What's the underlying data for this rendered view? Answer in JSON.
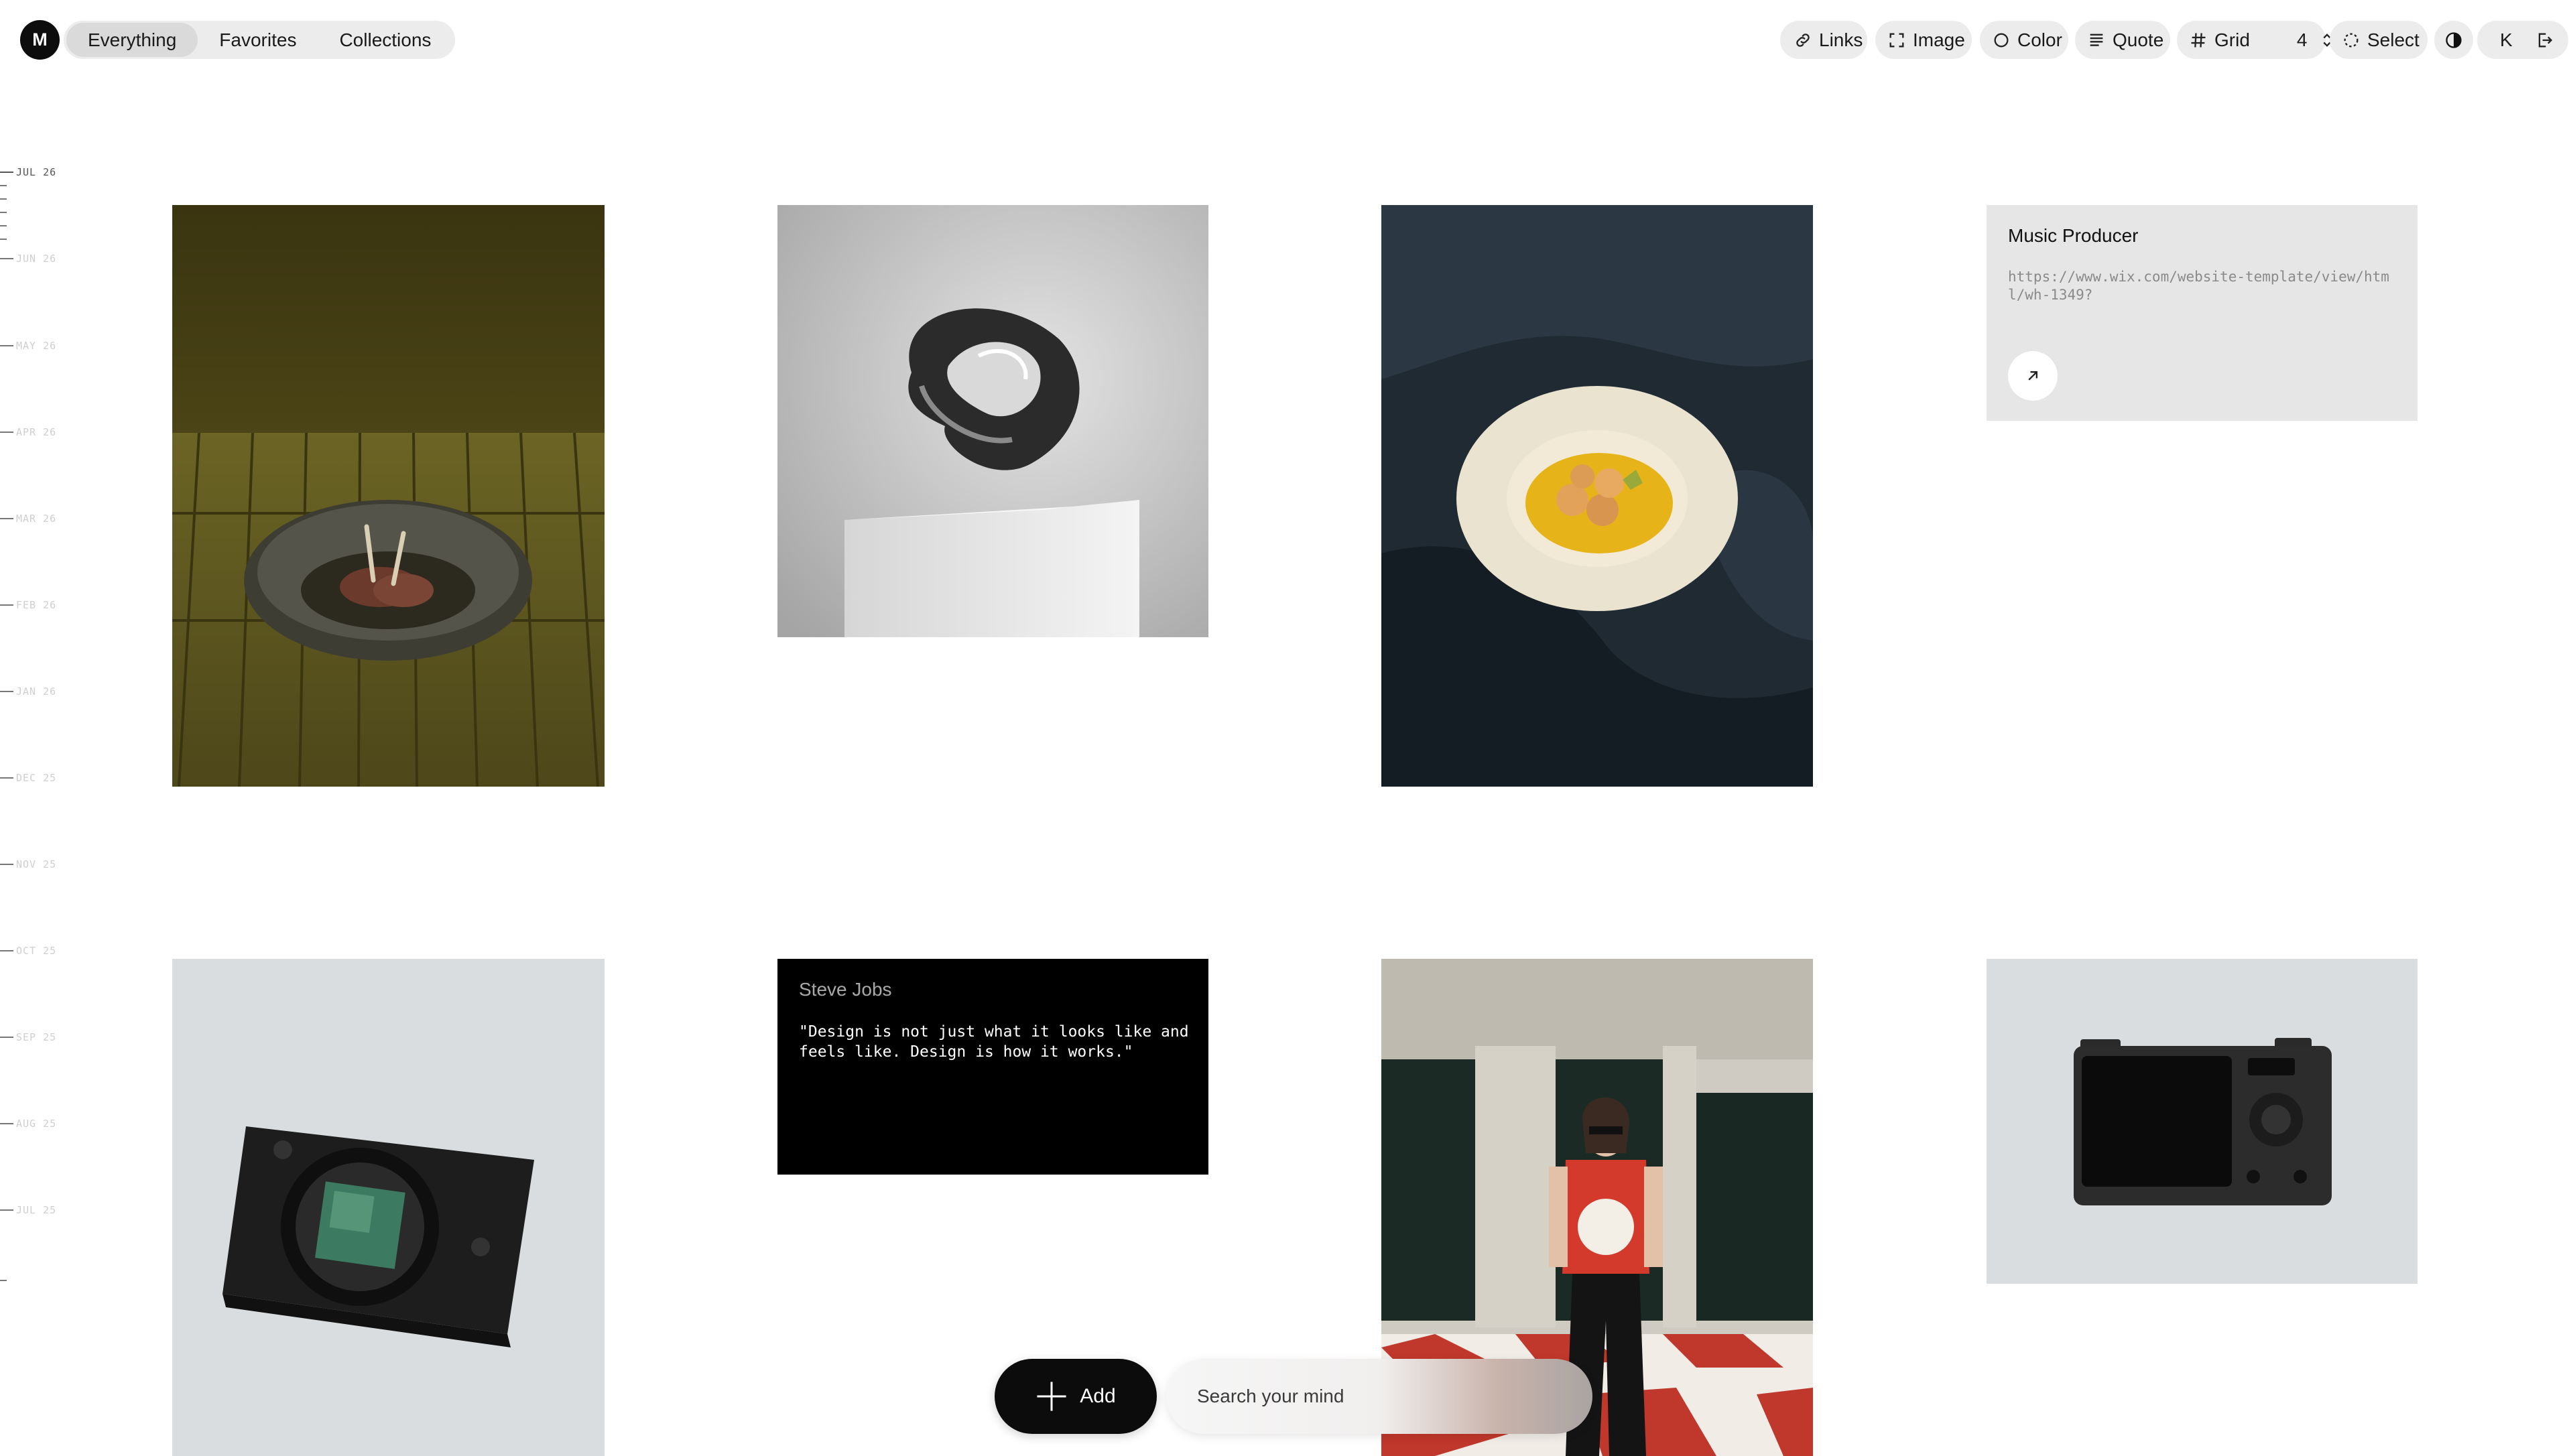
{
  "header": {
    "logo_text": "M",
    "nav_tabs": [
      {
        "label": "Everything",
        "active": true
      },
      {
        "label": "Favorites",
        "active": false
      },
      {
        "label": "Collections",
        "active": false
      }
    ],
    "tools": {
      "links": "Links",
      "image": "Image",
      "color": "Color",
      "quote": "Quote",
      "grid": "Grid",
      "grid_count": "4",
      "select": "Select",
      "shortcut": "K"
    }
  },
  "timeline": {
    "labels": [
      "JUL 26",
      "JUN 26",
      "MAY 26",
      "APR 26",
      "MAR 26",
      "FEB 26",
      "JAN 26",
      "DEC 25",
      "NOV 25",
      "OCT 25",
      "SEP 25",
      "AUG 25",
      "JUL 25"
    ],
    "current": "JUL 26"
  },
  "cards": {
    "link": {
      "title": "Music Producer",
      "url": "https://www.wix.com/website-template/view/html/wh-1349?"
    },
    "quote": {
      "author": "Steve Jobs",
      "text": "\"Design is not just what it looks like and feels like. Design is how it works.\""
    },
    "images": [
      {
        "name": "lamb-chops-dish",
        "description": "plated lamb chops on olive tiles"
      },
      {
        "name": "chrome-sculpture",
        "description": "abstract chrome sculpture on pedestal"
      },
      {
        "name": "scallops-plate",
        "description": "scallops on plate on dark velvet sofa"
      },
      {
        "name": "camera-render",
        "description": "black camera with green sensor"
      },
      {
        "name": "street-fashion",
        "description": "woman in red t-shirt on checkered floor"
      },
      {
        "name": "digital-camera",
        "description": "black digital camera front view"
      }
    ]
  },
  "bottom_bar": {
    "add_label": "Add",
    "search_placeholder": "Search your mind"
  },
  "colors": {
    "accent": "#0c0c0c",
    "card_grey": "#e6e6e6",
    "quote_bg": "#000000"
  }
}
